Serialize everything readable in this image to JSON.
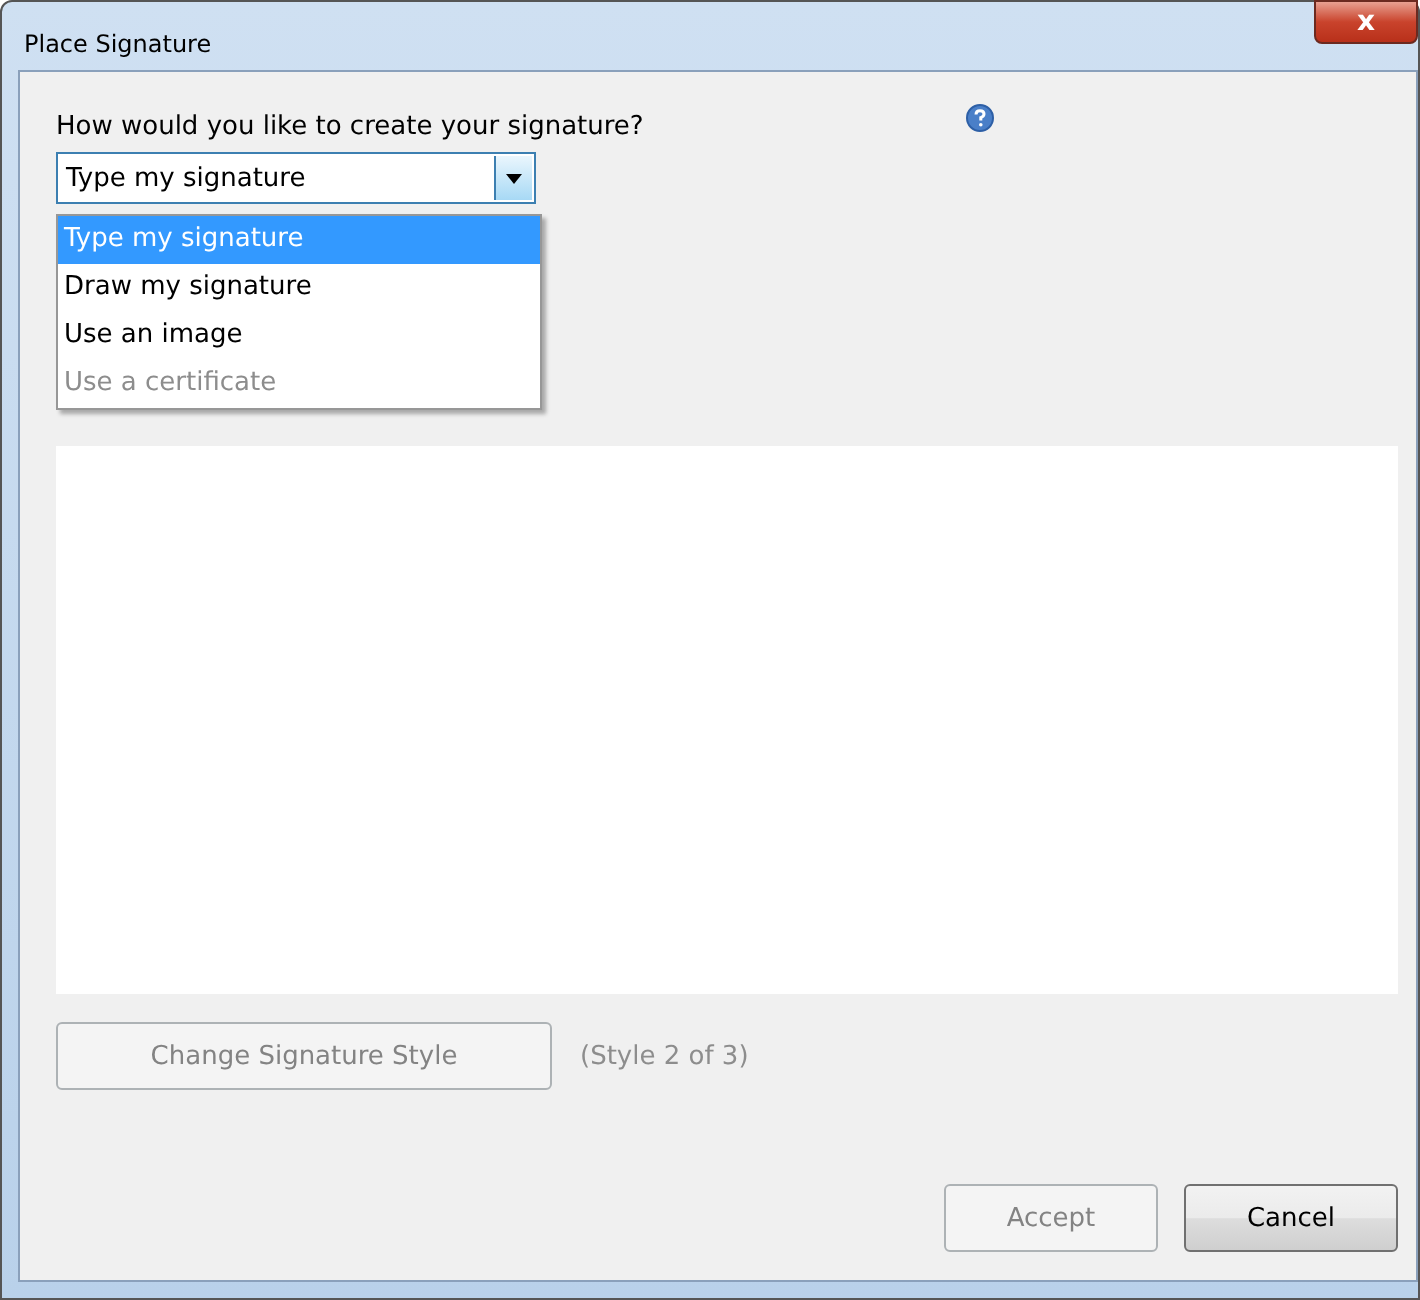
{
  "window": {
    "title": "Place Signature",
    "close_icon_label": "x"
  },
  "prompt": "How would you like to create your signature?",
  "method_select": {
    "value": "Type my signature",
    "expanded": true
  },
  "options": [
    {
      "label": "Type my signature",
      "selected": true,
      "disabled": false
    },
    {
      "label": "Draw my signature",
      "selected": false,
      "disabled": false
    },
    {
      "label": "Use an image",
      "selected": false,
      "disabled": false
    },
    {
      "label": "Use a certificate",
      "selected": false,
      "disabled": true
    }
  ],
  "style_button": {
    "label": "Change Signature Style",
    "disabled": true
  },
  "style_status": "(Style 2 of 3)",
  "buttons": [
    {
      "label": "Accept",
      "disabled": true
    },
    {
      "label": "Cancel",
      "disabled": false
    }
  ]
}
